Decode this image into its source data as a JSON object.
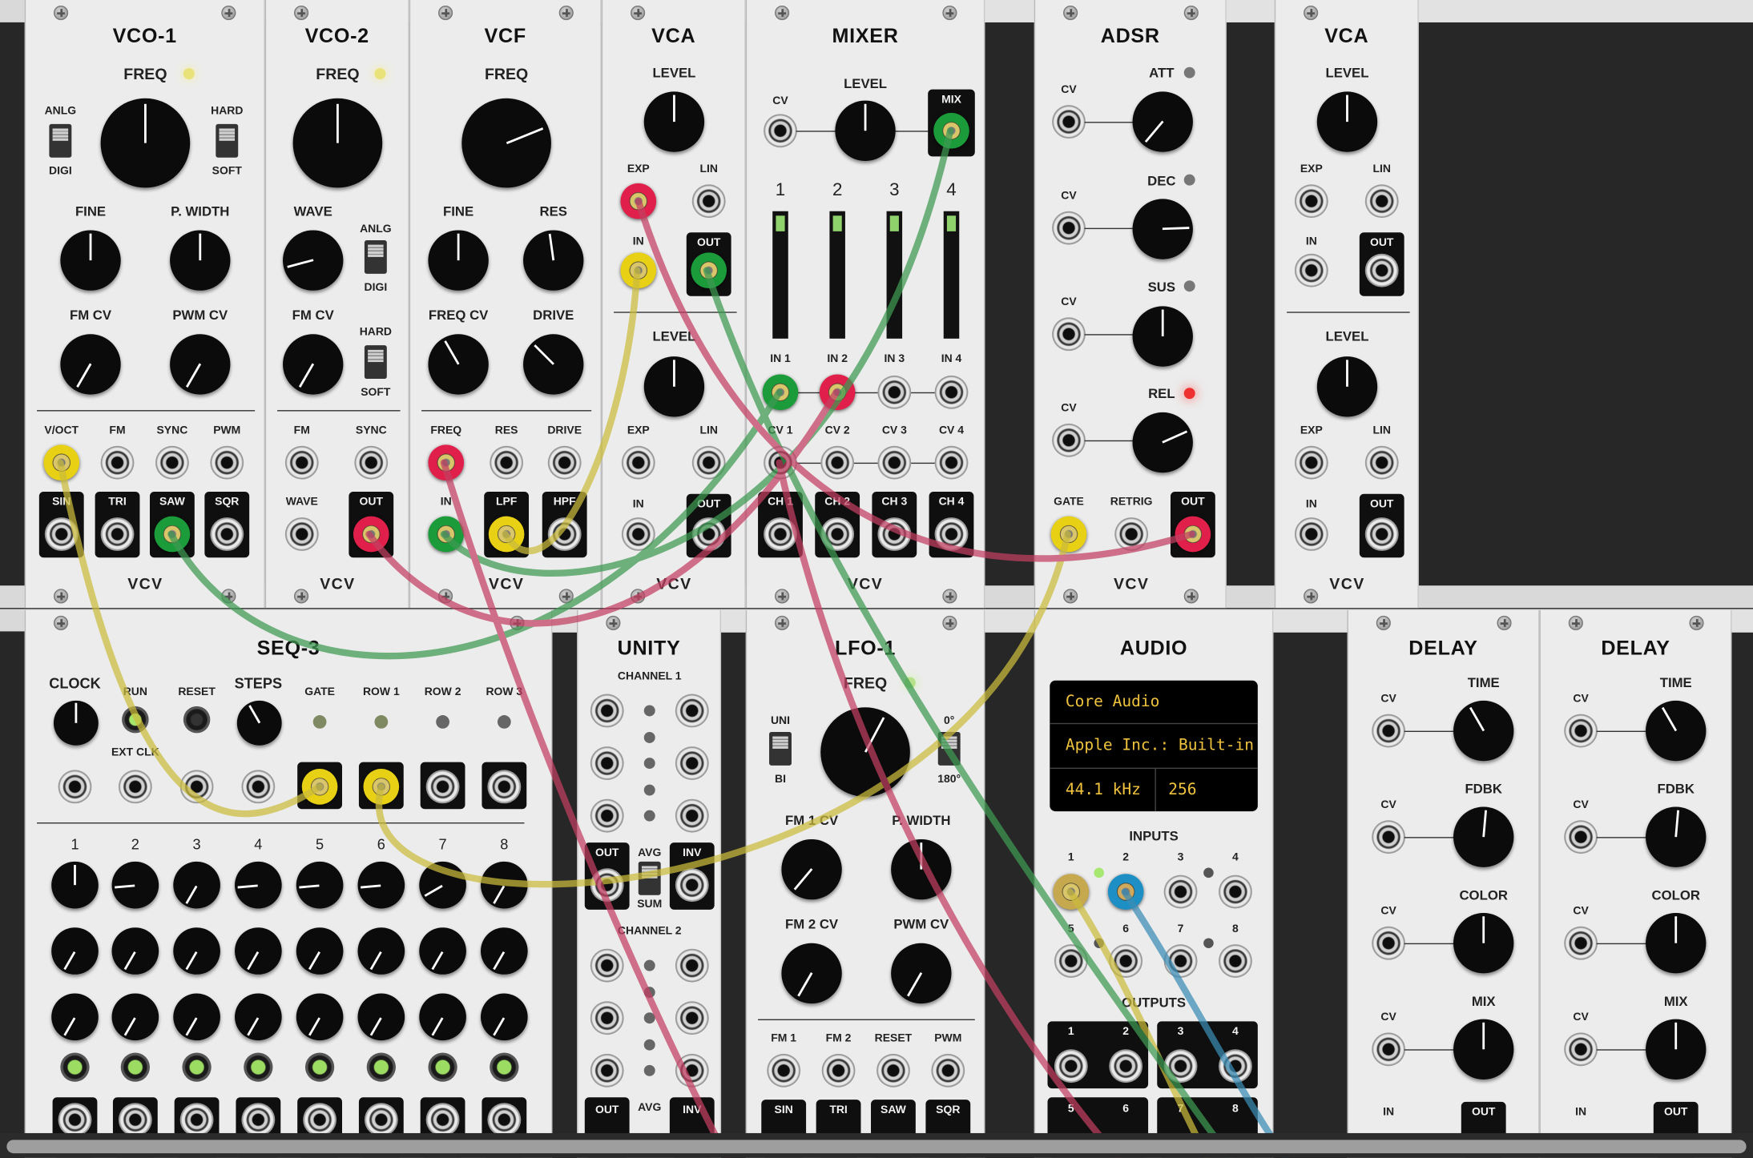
{
  "modules": {
    "vco1": {
      "title": "VCO-1",
      "freq": "FREQ",
      "anlg": "ANLG",
      "digi": "DIGI",
      "hard": "HARD",
      "soft": "SOFT",
      "fine": "FINE",
      "pwidth": "P. WIDTH",
      "fmcv": "FM CV",
      "pwmcv": "PWM CV",
      "voct": "V/OCT",
      "fm": "FM",
      "sync": "SYNC",
      "pwm": "PWM",
      "sin": "SIN",
      "tri": "TRI",
      "saw": "SAW",
      "sqr": "SQR",
      "logo": "VCV"
    },
    "vco2": {
      "title": "VCO-2",
      "freq": "FREQ",
      "wave": "WAVE",
      "anlg": "ANLG",
      "digi": "DIGI",
      "fmcv": "FM CV",
      "hard": "HARD",
      "soft": "SOFT",
      "fm": "FM",
      "sync": "SYNC",
      "wave_in": "WAVE",
      "out": "OUT",
      "logo": "VCV"
    },
    "vcf": {
      "title": "VCF",
      "freq": "FREQ",
      "fine": "FINE",
      "res": "RES",
      "freqcv": "FREQ CV",
      "drive": "DRIVE",
      "freq_in": "FREQ",
      "res_in": "RES",
      "drive_in": "DRIVE",
      "in": "IN",
      "lpf": "LPF",
      "hpf": "HPF",
      "logo": "VCV"
    },
    "vca1": {
      "title": "VCA",
      "level": "LEVEL",
      "exp": "EXP",
      "lin": "LIN",
      "in": "IN",
      "out": "OUT",
      "level2": "LEVEL",
      "exp2": "EXP",
      "lin2": "LIN",
      "in2": "IN",
      "out2": "OUT",
      "logo": "VCV"
    },
    "mixer": {
      "title": "MIXER",
      "cv": "CV",
      "level": "LEVEL",
      "mix": "MIX",
      "channels": [
        "1",
        "2",
        "3",
        "4"
      ],
      "ins": [
        "IN 1",
        "IN 2",
        "IN 3",
        "IN 4"
      ],
      "cvs": [
        "CV 1",
        "CV 2",
        "CV 3",
        "CV 4"
      ],
      "chs": [
        "CH 1",
        "CH 2",
        "CH 3",
        "CH 4"
      ],
      "logo": "VCV"
    },
    "adsr": {
      "title": "ADSR",
      "cv": "CV",
      "att": "ATT",
      "dec": "DEC",
      "sus": "SUS",
      "rel": "REL",
      "gate": "GATE",
      "retrig": "RETRIG",
      "out": "OUT",
      "logo": "VCV"
    },
    "vca2": {
      "title": "VCA",
      "level": "LEVEL",
      "exp": "EXP",
      "lin": "LIN",
      "in": "IN",
      "out": "OUT",
      "level2": "LEVEL",
      "exp2": "EXP",
      "lin2": "LIN",
      "in2": "IN",
      "out2": "OUT",
      "logo": "VCV"
    },
    "seq3": {
      "title": "SEQ-3",
      "clock": "CLOCK",
      "run": "RUN",
      "reset": "RESET",
      "steps": "STEPS",
      "extclk": "EXT CLK",
      "gate": "GATE",
      "row1": "ROW 1",
      "row2": "ROW 2",
      "row3": "ROW 3",
      "steps_nums": [
        "1",
        "2",
        "3",
        "4",
        "5",
        "6",
        "7",
        "8"
      ]
    },
    "unity": {
      "title": "UNITY",
      "ch1": "CHANNEL 1",
      "ch2": "CHANNEL 2",
      "out": "OUT",
      "avg": "AVG",
      "sum": "SUM",
      "inv": "INV",
      "out2": "OUT",
      "avg2": "AVG",
      "inv2": "INV"
    },
    "lfo1": {
      "title": "LFO-1",
      "freq": "FREQ",
      "uni": "UNI",
      "bi": "BI",
      "deg0": "0°",
      "deg180": "180°",
      "fm1cv": "FM 1 CV",
      "pwidth": "P. WIDTH",
      "fm2cv": "FM 2 CV",
      "pwmcv": "PWM CV",
      "fm1": "FM 1",
      "fm2": "FM 2",
      "reset": "RESET",
      "pwm": "PWM",
      "sin": "SIN",
      "tri": "TRI",
      "saw": "SAW",
      "sqr": "SQR"
    },
    "audio": {
      "title": "AUDIO",
      "driver": "Core Audio",
      "device": "Apple Inc.: Built-in",
      "rate": "44.1 kHz",
      "block": "256",
      "inputs": "INPUTS",
      "outputs": "OUTPUTS",
      "in_nums": [
        "1",
        "2",
        "3",
        "4",
        "5",
        "6",
        "7",
        "8"
      ],
      "out_nums": [
        "1",
        "2",
        "3",
        "4",
        "5",
        "6",
        "7",
        "8"
      ]
    },
    "delay1": {
      "title": "DELAY",
      "cv": "CV",
      "time": "TIME",
      "fdbk": "FDBK",
      "color": "COLOR",
      "mix": "MIX",
      "in": "IN",
      "out": "OUT"
    },
    "delay2": {
      "title": "DELAY",
      "cv": "CV",
      "time": "TIME",
      "fdbk": "FDBK",
      "color": "COLOR",
      "mix": "MIX",
      "in": "IN",
      "out": "OUT"
    }
  },
  "colors": {
    "red": "#e0204a",
    "green": "#1b9b3a",
    "yellow": "#e8d115",
    "blue": "#1e8fc5",
    "panel": "#ececec",
    "rack": "#272727"
  },
  "icons": [
    "screw-icon",
    "knob-icon",
    "jack-icon",
    "led-icon",
    "switch-icon"
  ]
}
